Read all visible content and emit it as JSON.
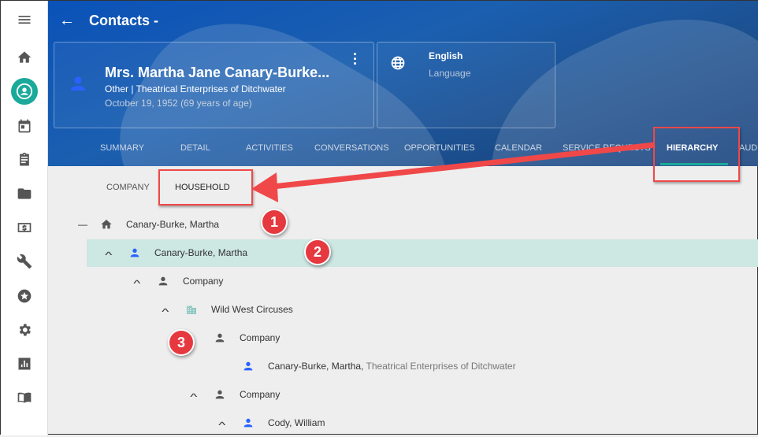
{
  "header": {
    "title": "Contacts -",
    "contact": {
      "name": "Mrs. Martha Jane Canary-Burke...",
      "subtitle": "Other | Theatrical Enterprises of Ditchwater",
      "dob": "October 19, 1952 (69 years of age)"
    },
    "language": {
      "value": "English",
      "label": "Language"
    },
    "tabs": [
      "SUMMARY",
      "DETAIL",
      "ACTIVITIES",
      "CONVERSATIONS",
      "OPPORTUNITIES",
      "CALENDAR",
      "SERVICE REQUESTS",
      "HIERARCHY",
      "AUDI"
    ],
    "active_tab": "HIERARCHY"
  },
  "subtabs": [
    "COMPANY",
    "HOUSEHOLD"
  ],
  "active_subtab": "HOUSEHOLD",
  "tree": [
    {
      "toggle": "—",
      "icon": "home-icon",
      "label": "Canary-Burke, Martha"
    },
    {
      "toggle": "^",
      "icon": "person-icon",
      "label": "Canary-Burke, Martha",
      "selected": true
    },
    {
      "toggle": "^",
      "icon": "person-icon",
      "label": "Company"
    },
    {
      "toggle": "^",
      "icon": "building-icon",
      "label": "Wild West Circuses"
    },
    {
      "toggle": "",
      "icon": "person-icon",
      "label": "Company"
    },
    {
      "toggle": "",
      "icon": "person-icon",
      "label": "Canary-Burke, Martha,",
      "extra": "Theatrical Enterprises of Ditchwater"
    },
    {
      "toggle": "^",
      "icon": "person-icon",
      "label": "Company"
    },
    {
      "toggle": "^",
      "icon": "person-icon",
      "label": "Cody, William"
    }
  ],
  "annotations": [
    "1",
    "2",
    "3"
  ],
  "colors": {
    "accent": "#1aa99a",
    "annotation": "#e5393f",
    "selected_row": "#cde7e3",
    "contact_icon": "#2962ff"
  }
}
